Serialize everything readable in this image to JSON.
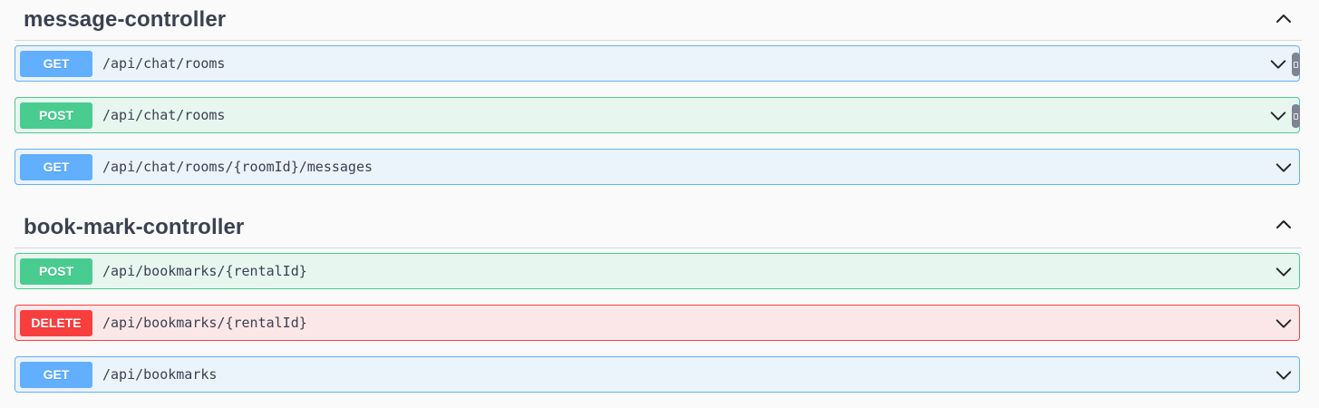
{
  "controllers": [
    {
      "name": "message-controller",
      "operations": [
        {
          "method": "GET",
          "path": "/api/chat/rooms"
        },
        {
          "method": "POST",
          "path": "/api/chat/rooms"
        },
        {
          "method": "GET",
          "path": "/api/chat/rooms/{roomId}/messages"
        }
      ]
    },
    {
      "name": "book-mark-controller",
      "operations": [
        {
          "method": "POST",
          "path": "/api/bookmarks/{rentalId}"
        },
        {
          "method": "DELETE",
          "path": "/api/bookmarks/{rentalId}"
        },
        {
          "method": "GET",
          "path": "/api/bookmarks"
        }
      ]
    }
  ],
  "icons": {
    "collapse": "chevron-up-icon",
    "expand": "chevron-down-icon",
    "copy": "copy-to-clipboard-icon"
  },
  "colors": {
    "get": "#61affe",
    "post": "#49cc90",
    "delete": "#f93e3e",
    "text": "#3b4151"
  }
}
